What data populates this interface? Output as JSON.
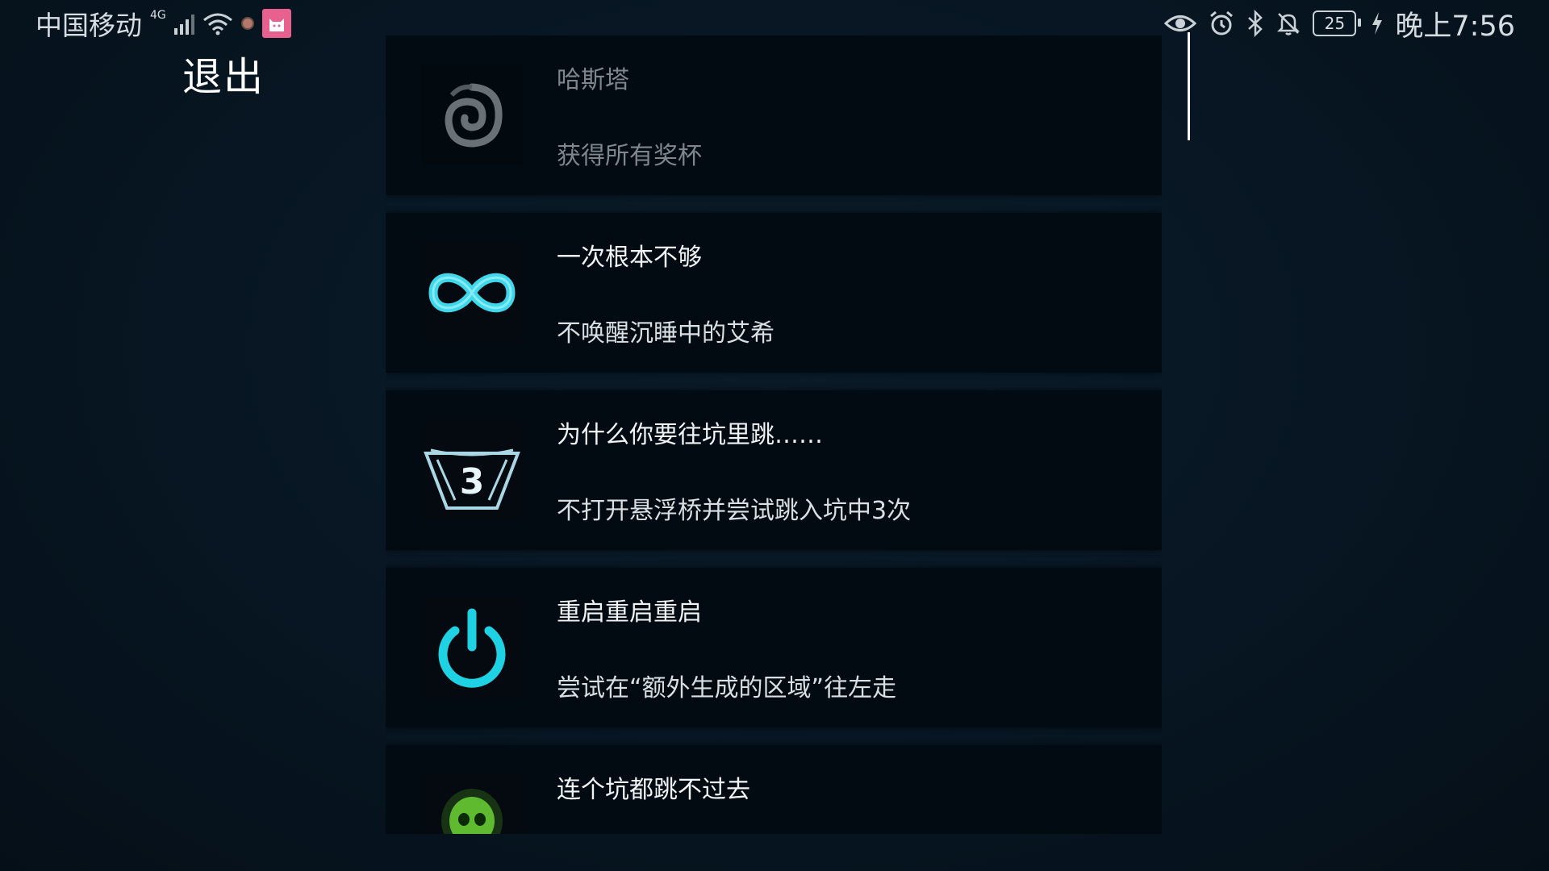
{
  "status_bar": {
    "carrier": "中国移动",
    "network": "4G",
    "battery": "25",
    "time": "晚上7:56",
    "icons": [
      "signal-icon",
      "wifi-icon",
      "notification-dot-icon",
      "cat-app-icon",
      "eye-icon",
      "alarm-icon",
      "bluetooth-icon",
      "mute-bell-icon",
      "battery-icon",
      "charging-icon"
    ]
  },
  "header": {
    "exit_label": "退出"
  },
  "achievements": [
    {
      "title": "哈斯塔",
      "description": "获得所有奖杯",
      "icon": "spiral-icon",
      "locked": true
    },
    {
      "title": "一次根本不够",
      "description": "不唤醒沉睡中的艾希",
      "icon": "infinity-icon",
      "locked": false
    },
    {
      "title": "为什么你要往坑里跳……",
      "description": "不打开悬浮桥并尝试跳入坑中3次",
      "icon": "pit-three-icon",
      "icon_text": "3",
      "locked": false
    },
    {
      "title": "重启重启重启",
      "description": "尝试在“额外生成的区域”往左走",
      "icon": "power-icon",
      "locked": false
    },
    {
      "title": "连个坑都跳不过去",
      "description": "",
      "icon": "skull-icon",
      "locked": false
    }
  ],
  "colors": {
    "background": "#071622",
    "card": "#030b12",
    "accent_cyan": "#22d3e6",
    "skull_green": "#6fd13a"
  }
}
